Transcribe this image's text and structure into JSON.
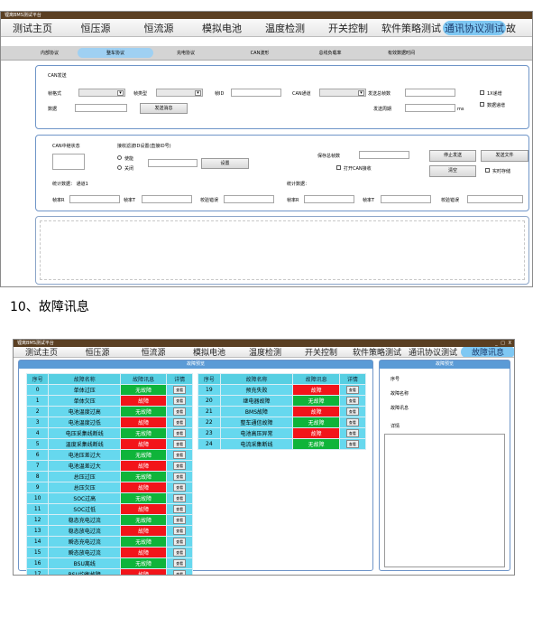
{
  "top": {
    "window_title": "锂离BMS测试平台",
    "tabs": [
      "测试主页",
      "恒压源",
      "恒流源",
      "模拟电池",
      "温度检测",
      "开关控制",
      "软件策略测试",
      "通讯协议测试",
      "故"
    ],
    "selected_tab": 7,
    "subtabs": [
      "内部协议",
      "整车协议",
      "充电协议",
      "CAN波形",
      "总线负载率",
      "有效数据时间"
    ],
    "selected_subtab": 1,
    "can_send": {
      "group_title": "CAN发送",
      "frame_format": "帧格式",
      "frame_type": "帧类型",
      "frame_id": "帧ID",
      "can_channel": "CAN通道",
      "send_total": "发送总帧数",
      "data": "数据",
      "send_message": "发送消息",
      "send_period": "发送周期",
      "ms": "ms",
      "cb_1x": "1X递增",
      "cb_data_inc": "数据递增"
    },
    "relay": {
      "status_label": "CAN中继状态",
      "filter_label": "接收滤波ID设置(直接ID号)",
      "enable": "使能",
      "disable": "关闭",
      "set": "设置",
      "stats_data": "统计数据： 通道1",
      "stats_data2": "统计数据：",
      "save_total": "保存总帧数",
      "open_can_recv": "打开CAN接收",
      "stop_send": "停止发送",
      "send_file": "发送文件",
      "clear": "清空",
      "realtime_save": "实时存储",
      "frame_r1": "帧率R",
      "frame_t1": "帧率T",
      "verify_err1": "校验错误",
      "frame_r2": "帧率R",
      "frame_t2": "帧率T",
      "verify_err2": "校验错误"
    }
  },
  "heading": "10、故障讯息",
  "bottom": {
    "window_title": "锂离BMS测试平台",
    "tabs": [
      "测试主页",
      "恒压源",
      "恒流源",
      "模拟电池",
      "温度检测",
      "开关控制",
      "软件策略测试",
      "通讯协议测试",
      "故障讯息"
    ],
    "selected_tab": 8,
    "window_controls": [
      "_",
      "□",
      "X"
    ],
    "panel_title": "故障预览",
    "detail_title": "故障预览",
    "columns": [
      "序号",
      "故障名称",
      "故障讯息",
      "详情"
    ],
    "view_label": "查看",
    "left_rows": [
      {
        "no": "0",
        "name": "单体过压",
        "msg": "无故障",
        "st": "ok"
      },
      {
        "no": "1",
        "name": "单体欠压",
        "msg": "故障",
        "st": "bad"
      },
      {
        "no": "2",
        "name": "电池温度过高",
        "msg": "无故障",
        "st": "ok"
      },
      {
        "no": "3",
        "name": "电池温度过低",
        "msg": "故障",
        "st": "bad"
      },
      {
        "no": "4",
        "name": "电压采集线断线",
        "msg": "无故障",
        "st": "ok"
      },
      {
        "no": "5",
        "name": "温度采集线断线",
        "msg": "故障",
        "st": "bad"
      },
      {
        "no": "6",
        "name": "电池压差过大",
        "msg": "无故障",
        "st": "ok"
      },
      {
        "no": "7",
        "name": "电池温差过大",
        "msg": "故障",
        "st": "bad"
      },
      {
        "no": "8",
        "name": "总压过压",
        "msg": "无故障",
        "st": "ok"
      },
      {
        "no": "9",
        "name": "总压欠压",
        "msg": "故障",
        "st": "bad"
      },
      {
        "no": "10",
        "name": "SOC过高",
        "msg": "无故障",
        "st": "ok"
      },
      {
        "no": "11",
        "name": "SOC过低",
        "msg": "故障",
        "st": "bad"
      },
      {
        "no": "12",
        "name": "稳态充电过流",
        "msg": "无故障",
        "st": "ok"
      },
      {
        "no": "13",
        "name": "稳态放电过流",
        "msg": "故障",
        "st": "bad"
      },
      {
        "no": "14",
        "name": "瞬态充电过流",
        "msg": "无故障",
        "st": "ok"
      },
      {
        "no": "15",
        "name": "瞬态放电过流",
        "msg": "故障",
        "st": "bad"
      },
      {
        "no": "16",
        "name": "BSU离线",
        "msg": "无故障",
        "st": "ok"
      },
      {
        "no": "17",
        "name": "BSU均衡故障",
        "msg": "故障",
        "st": "bad"
      }
    ],
    "right_rows": [
      {
        "no": "19",
        "name": "预充失败",
        "msg": "故障",
        "st": "bad"
      },
      {
        "no": "20",
        "name": "继电器故障",
        "msg": "无故障",
        "st": "ok"
      },
      {
        "no": "21",
        "name": "BMS故障",
        "msg": "故障",
        "st": "bad"
      },
      {
        "no": "22",
        "name": "整车通信故障",
        "msg": "无故障",
        "st": "ok"
      },
      {
        "no": "23",
        "name": "电池高压异常",
        "msg": "故障",
        "st": "bad"
      },
      {
        "no": "24",
        "name": "电流采集断线",
        "msg": "无故障",
        "st": "ok"
      }
    ],
    "detail_labels": [
      "序号",
      "故障名称",
      "故障讯息",
      "详情"
    ]
  },
  "colors": {
    "ok": "#0fb43a",
    "bad": "#f2141a",
    "cell": "#66d8ee",
    "accent": "#7fc8f3"
  }
}
